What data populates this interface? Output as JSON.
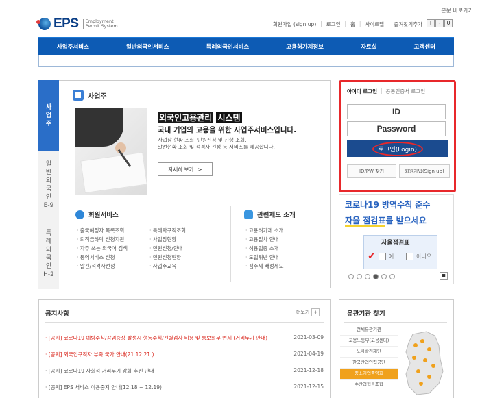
{
  "header": {
    "skip_label": "본문 바로가기",
    "logo_text": "EPS",
    "logo_sub_1": "Employment",
    "logo_sub_2": "Permit System",
    "util_links": [
      "회원가입 (sign up)",
      "로그인",
      "홈",
      "사이트맵",
      "즐겨찾기추가"
    ],
    "zoom": [
      "+",
      "-",
      "0"
    ]
  },
  "gnb": [
    "사업주서비스",
    "일반외국인서비스",
    "특례외국인서비스",
    "고용허가제정보",
    "자료실",
    "고객센터"
  ],
  "side_tabs": [
    {
      "label": "사\n업\n주"
    },
    {
      "label": "일\n반\n외\n국\n인\nE-9"
    },
    {
      "label": "특\n례\n외\n국\n인\nH-2"
    }
  ],
  "employer": {
    "heading": "사업주",
    "title_a": "외국인고용관리",
    "title_b": "시스템",
    "desc": "국내 기업의 고용을 위한 사업주서비스입니다.",
    "small_1": "사업장 현황 조회, 민원신청 및 진행 조회,",
    "small_2": "알선현황 조회 및 적격자 선정 등 서비스를 제공합니다.",
    "more": "자세히 보기",
    "more_arrow": ">"
  },
  "member": {
    "heading": "회원서비스",
    "col1": [
      "출국예정자 목록조회",
      "퇴직금하락 신청지원",
      "자주 쓰는 외국어 검색",
      "통역서비스 신청",
      "알선/적격자선정"
    ],
    "col2": [
      "특례자구직조회",
      "사업장현황",
      "민원신청/안내",
      "민원신청현황",
      "사업주교육"
    ]
  },
  "related": {
    "heading": "관련제도 소개",
    "items": [
      "고용허가제 소개",
      "고용절차 안내",
      "허용업종 소개",
      "도입위반 안내",
      "점수제 배정제도"
    ]
  },
  "login": {
    "tab_on": "아이디 로그인",
    "tab_off": "공동인증서 로그인",
    "id": "ID",
    "pw": "Password",
    "btn": "로그인(Login)",
    "find": "ID/PW 찾기",
    "signup": "회원가입(Sign up)"
  },
  "corona": {
    "line1": "코로나19 방역수칙 준수",
    "line2_u": "자율 점검표",
    "line2": "를 받으세요",
    "card_title": "자율점검표",
    "yes": "예",
    "no": "아니오",
    "dots": 6,
    "active_dot": 3,
    "pause": "■"
  },
  "notice": {
    "title": "공지사항",
    "more": "더보기",
    "more_icon": "+",
    "rows": [
      {
        "text": "· [공지] 코로나19 예방수칙/감염증상 발생시 행동수칙/선별검사 비용 및 통보의무 면제 (거리두기 안내)",
        "date": "2021-03-09",
        "style": "red"
      },
      {
        "text": "· [공지] 외국인구직자 부족 국가 안내(21.12.21.)",
        "date": "2021-04-19",
        "style": "red"
      },
      {
        "text": "· [공지] 코로나19 사회적 거리두기 강화 추진 안내",
        "date": "2021-12-18",
        "style": "gray"
      },
      {
        "text": "· [공지] EPS 서비스 이용중지 안내(12.18 ~ 12.19)",
        "date": "2021-12-15",
        "style": "gray"
      }
    ]
  },
  "agency": {
    "title": "유관기관 찾기",
    "items": [
      "전체유관기관",
      "고용노동부(고용센터)",
      "노사발전재단",
      "한국산업인력공단",
      "중소기업중앙회",
      "수산업협동조합"
    ],
    "active": 4
  },
  "colors": {
    "brand": "#0d5bb4",
    "highlight": "#e8282b",
    "accent": "#f0a11c"
  }
}
